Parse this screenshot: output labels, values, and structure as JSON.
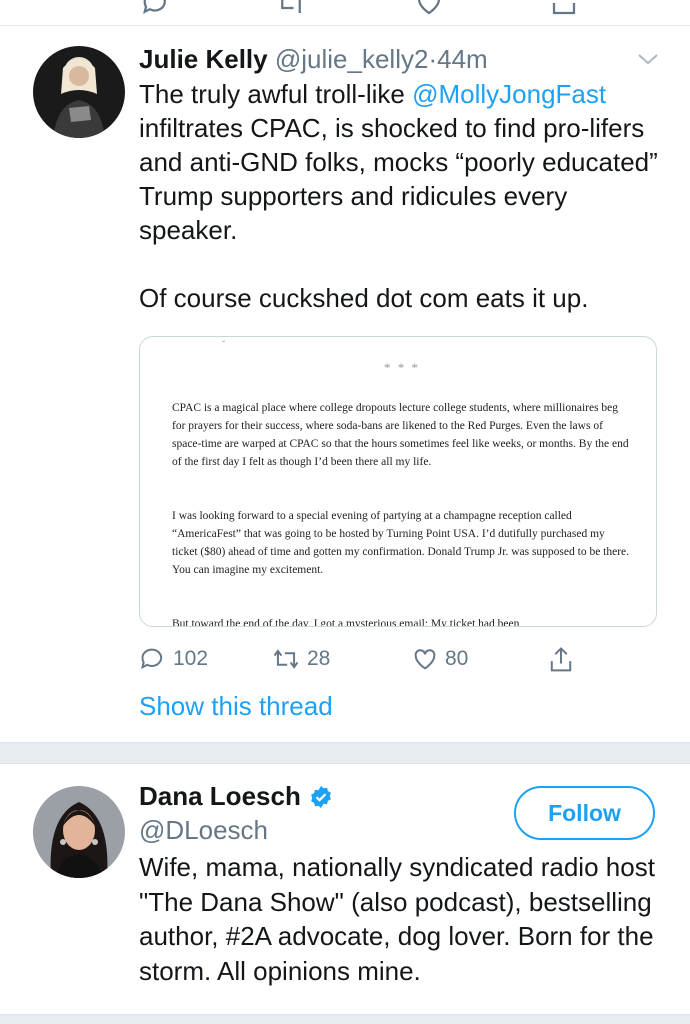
{
  "prev_tweet_actions": {
    "icons": [
      "reply-icon",
      "retweet-icon",
      "like-icon",
      "share-icon"
    ]
  },
  "tweet": {
    "author_name": "Julie Kelly",
    "handle": "@julie_kelly2",
    "separator": "·",
    "time": "44m",
    "text_before_mention": "The truly awful troll-like ",
    "mention": "@MollyJongFast",
    "text_after_mention": " infiltrates CPAC, is shocked to find pro-lifers and anti-GND folks, mocks “poorly educated” Trump supporters and ridicules every speaker.",
    "text_para2": "Of course cuckshed dot com eats it up.",
    "media": {
      "stars": "* * *",
      "para1": "CPAC is a magical place where college dropouts lecture college students, where millionaires beg for prayers for their success, where soda-bans are likened to the Red Purges. Even the laws of space-time are warped at CPAC so that the hours sometimes feel like weeks, or months. By the end of the first day I felt as though I’d been there all my life.",
      "para2": "I was looking forward to a special evening of partying at a champagne reception called “AmericaFest” that was going to be hosted by Turning Point USA. I’d dutifully purchased my ticket ($80) ahead of time and gotten my confirmation. Donald Trump Jr. was supposed to be there. You can imagine my excitement.",
      "para3": "But toward the end of the day, I got a mysterious email: My ticket had been"
    },
    "reply_count": "102",
    "retweet_count": "28",
    "like_count": "80",
    "show_thread": "Show this thread"
  },
  "profile_card": {
    "name": "Dana Loesch",
    "handle": "@DLoesch",
    "follow_label": "Follow",
    "bio": "Wife, mama, nationally syndicated radio host \"The Dana Show\" (also podcast), bestselling author, #2A advocate, dog lover. Born for the storm. All opinions mine."
  },
  "colors": {
    "accent": "#1da1f2",
    "muted": "#657786",
    "text": "#14171a",
    "separator": "#e6ecf0"
  }
}
